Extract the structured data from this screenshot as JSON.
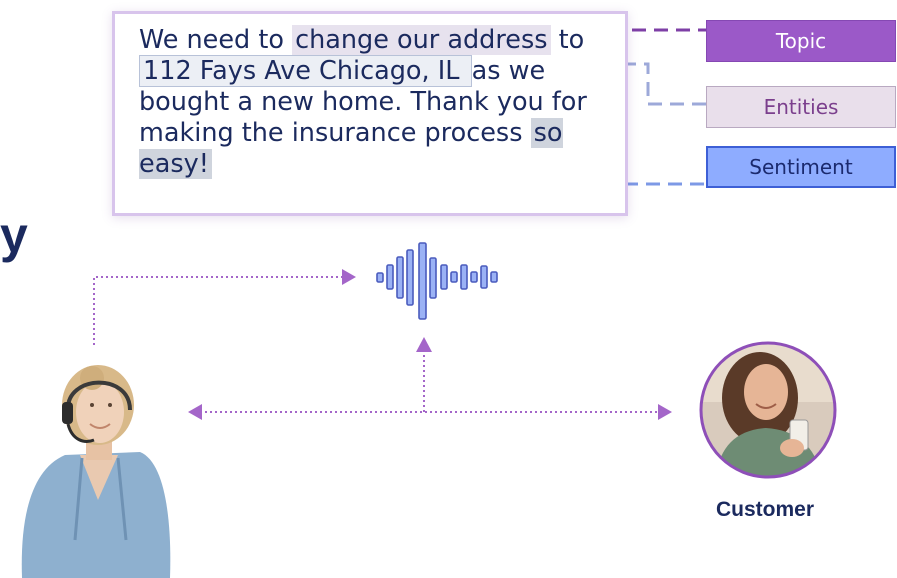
{
  "transcript": {
    "segments": [
      {
        "text": "We need to ",
        "kind": "plain"
      },
      {
        "text": "change our address",
        "kind": "topic"
      },
      {
        "text": " to ",
        "kind": "plain"
      },
      {
        "text": "112 Fays Ave Chicago, IL ",
        "kind": "entity"
      },
      {
        "text": "as we bought a new home.  Thank you for making the insurance process ",
        "kind": "plain"
      },
      {
        "text": "so easy!",
        "kind": "sentiment"
      }
    ]
  },
  "tags": {
    "topic": "Topic",
    "entities": "Entities",
    "sentiment": "Sentiment"
  },
  "heading_fragment": "y",
  "customer_label": "Customer",
  "icons": {
    "waveform": "audio-waveform-icon",
    "agent": "agent-with-headset-photo",
    "customer": "customer-photo"
  },
  "colors": {
    "topic": "#9b59c8",
    "entities": "#e9dfeb",
    "sentiment": "#8eacff",
    "arrow": "#a466c9",
    "text": "#1b2a5e"
  }
}
